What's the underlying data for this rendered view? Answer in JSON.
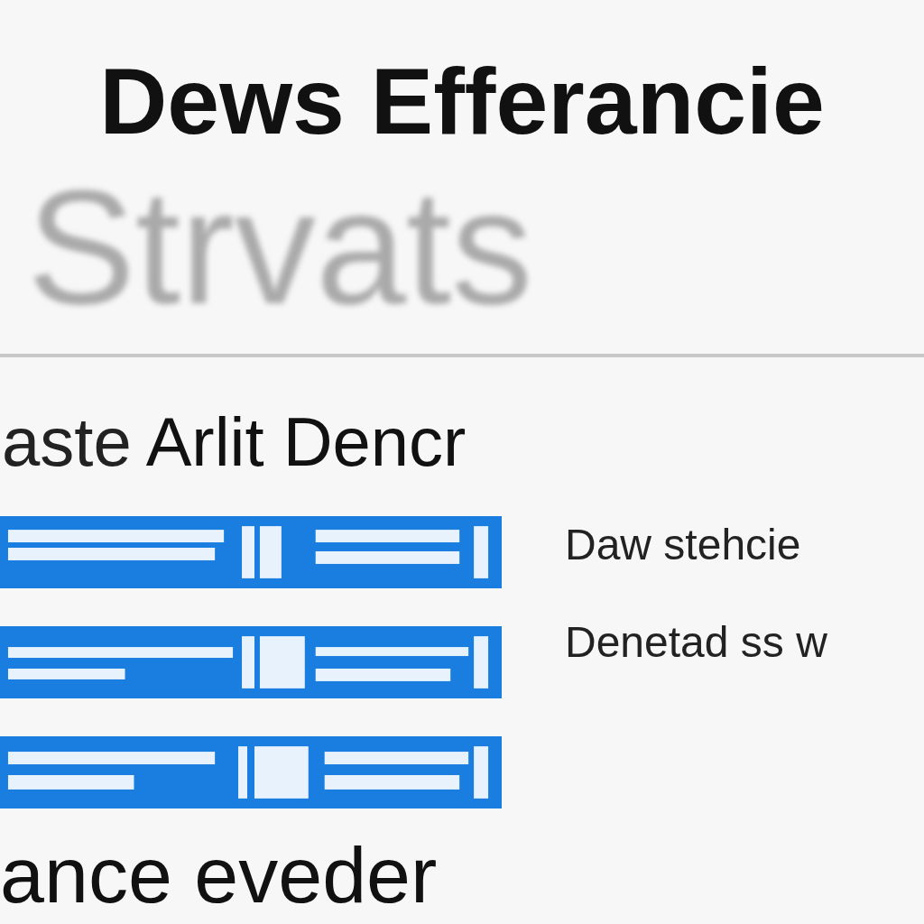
{
  "header": {
    "title": "Dews Efferancie",
    "subtitle": "Strvats"
  },
  "section": {
    "heading_prefix": "aste",
    "heading": "Arlit Dencr"
  },
  "bars": [
    {
      "kind": "picture"
    },
    {
      "kind": "picture"
    },
    {
      "kind": "picture"
    }
  ],
  "side_labels": [
    "Daw stehcie",
    "Denetad ss w"
  ],
  "footer": {
    "text": "ance eveder"
  }
}
